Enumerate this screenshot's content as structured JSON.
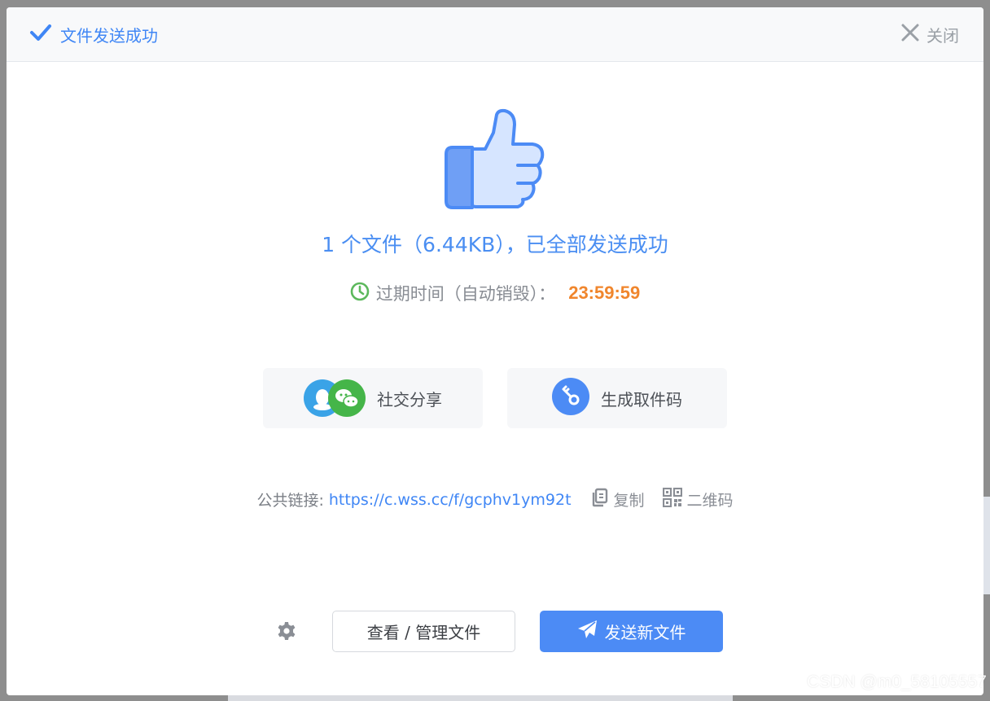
{
  "header": {
    "title": "文件发送成功",
    "close_label": "关闭"
  },
  "summary": {
    "text": "1 个文件（6.44KB），已全部发送成功"
  },
  "expiry": {
    "label": "过期时间（自动销毁）：",
    "countdown": "23:59:59"
  },
  "actions": {
    "share_label": "社交分享",
    "code_label": "生成取件码"
  },
  "link": {
    "label": "公共链接:",
    "url": "https://c.wss.cc/f/gcphv1ym92t",
    "copy_label": "复制",
    "qr_label": "二维码"
  },
  "footer": {
    "manage_label": "查看 / 管理文件",
    "send_label": "发送新文件"
  },
  "watermark": "CSDN @m0_58105557",
  "icons": {
    "header": "check-icon",
    "close": "close-icon",
    "hero": "thumbs-up-icon",
    "expiry": "clock-icon",
    "share": [
      "qq-icon",
      "wechat-icon"
    ],
    "code": "key-icon",
    "copy": "copy-icon",
    "qr": "qr-code-icon",
    "settings": "gear-icon",
    "send": "paper-plane-icon"
  },
  "colors": {
    "accent": "#4c8bf5",
    "countdown": "#f0862d",
    "clock": "#5cb85c"
  }
}
